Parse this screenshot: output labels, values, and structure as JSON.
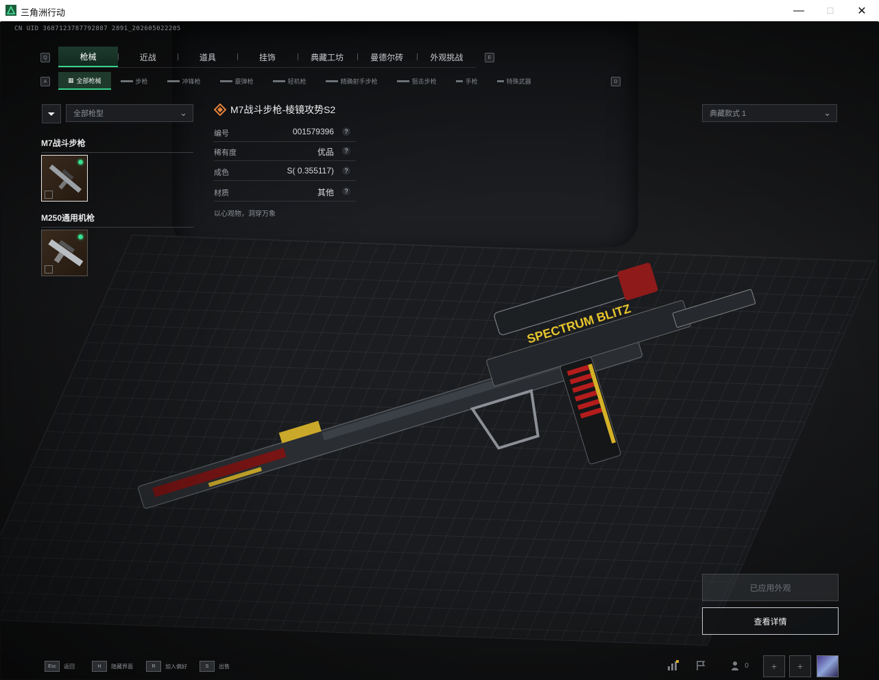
{
  "window": {
    "title": "三角洲行动",
    "minimize": "—",
    "maximize": "☐",
    "close": "✕"
  },
  "uid": "CN UID 3687123787792887 2891_202605022205",
  "key_hints": {
    "q": "Q",
    "e": "E",
    "a": "A",
    "d": "D"
  },
  "tabs": [
    {
      "label": "枪械",
      "active": true
    },
    {
      "label": "近战"
    },
    {
      "label": "道具"
    },
    {
      "label": "挂饰"
    },
    {
      "label": "典藏工坊"
    },
    {
      "label": "曼德尔砖"
    },
    {
      "label": "外观挑战"
    }
  ],
  "subtabs": [
    {
      "label": "全部枪械",
      "active": true
    },
    {
      "label": "步枪"
    },
    {
      "label": "冲锋枪"
    },
    {
      "label": "霰弹枪"
    },
    {
      "label": "轻机枪"
    },
    {
      "label": "精确射手步枪"
    },
    {
      "label": "狙击步枪"
    },
    {
      "label": "手枪"
    },
    {
      "label": "特殊武器"
    }
  ],
  "filter": {
    "icon": "filter-icon",
    "select_value": "全部枪型"
  },
  "groups": [
    {
      "title": "M7战斗步枪"
    },
    {
      "title": "M250通用机枪"
    }
  ],
  "skin": {
    "name": "M7战斗步枪-棱镜攻势S2",
    "rarity_color": "#e8833a",
    "attributes": [
      {
        "key": "编号",
        "value": "001579396"
      },
      {
        "key": "稀有度",
        "value": "优品"
      },
      {
        "key": "成色",
        "value": "S( 0.355117)"
      },
      {
        "key": "材质",
        "value": "其他"
      }
    ],
    "help_glyph": "?",
    "description": "以心观物，洞穿万象"
  },
  "collection_select": "典藏款式 1",
  "buttons": {
    "applied": "已应用外观",
    "detail": "查看详情"
  },
  "bottom_hints": [
    {
      "key": "Esc",
      "label": "返回"
    },
    {
      "key": "H",
      "label": "隐藏界面"
    },
    {
      "key": "R",
      "label": "加入偏好"
    },
    {
      "key": "S",
      "label": "出售"
    }
  ],
  "bottom_right": {
    "players_count": "0",
    "plus": "+"
  },
  "rifle_decal": "SPECTRUM BLITZ",
  "accent_color": "#35d28a"
}
